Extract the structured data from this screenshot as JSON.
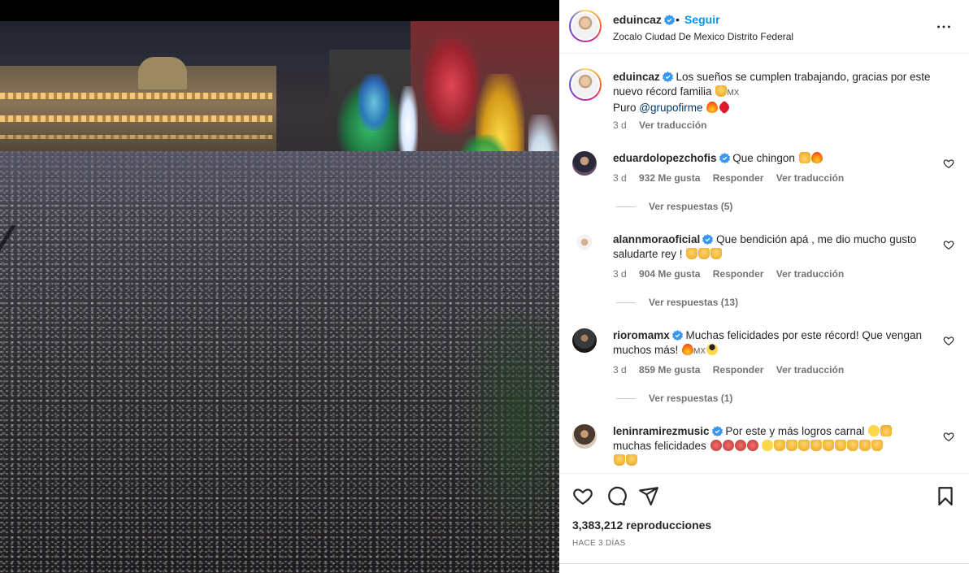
{
  "post": {
    "username": "eduincaz",
    "follow_label": "Seguir",
    "dot": "•",
    "location": "Zocalo Ciudad De Mexico Distrito Federal"
  },
  "caption": {
    "username": "eduincaz",
    "text_1": "Los sueños se cumplen trabajando, gracias por este nuevo récord familia",
    "mx": "MX",
    "text_2": "Puro",
    "mention": "@grupofirme",
    "time": "3 d",
    "translate": "Ver traducción"
  },
  "comments": [
    {
      "username": "eduardolopezchofis",
      "text": "Que chingon",
      "time": "3 d",
      "likes": "932 Me gusta",
      "reply": "Responder",
      "translate": "Ver traducción",
      "replies": "Ver respuestas (5)"
    },
    {
      "username": "alannmoraoficial",
      "text": "Que bendición apá , me dio mucho gusto saludarte rey !",
      "time": "3 d",
      "likes": "904 Me gusta",
      "reply": "Responder",
      "translate": "Ver traducción",
      "replies": "Ver respuestas (13)"
    },
    {
      "username": "rioromamx",
      "text": "Muchas felicidades por este récord! Que vengan muchos más!",
      "mx": "MX",
      "time": "3 d",
      "likes": "859 Me gusta",
      "reply": "Responder",
      "translate": "Ver traducción",
      "replies": "Ver respuestas (1)"
    },
    {
      "username": "leninramirezmusic",
      "text_1": "Por este y más logros carnal",
      "text_2": "muchas felicidades"
    }
  ],
  "footer": {
    "views": "3,383,212 reproducciones",
    "ago": "HACE 3 DÍAS"
  },
  "icons": {
    "verified": "verified-badge-icon",
    "more": "more-options-icon",
    "heart": "heart-icon",
    "comment": "comment-icon",
    "share": "share-icon",
    "save": "bookmark-icon"
  },
  "colors": {
    "accent": "#0095f6",
    "verified": "#3897f0",
    "mention": "#00376b",
    "muted": "#737373"
  }
}
